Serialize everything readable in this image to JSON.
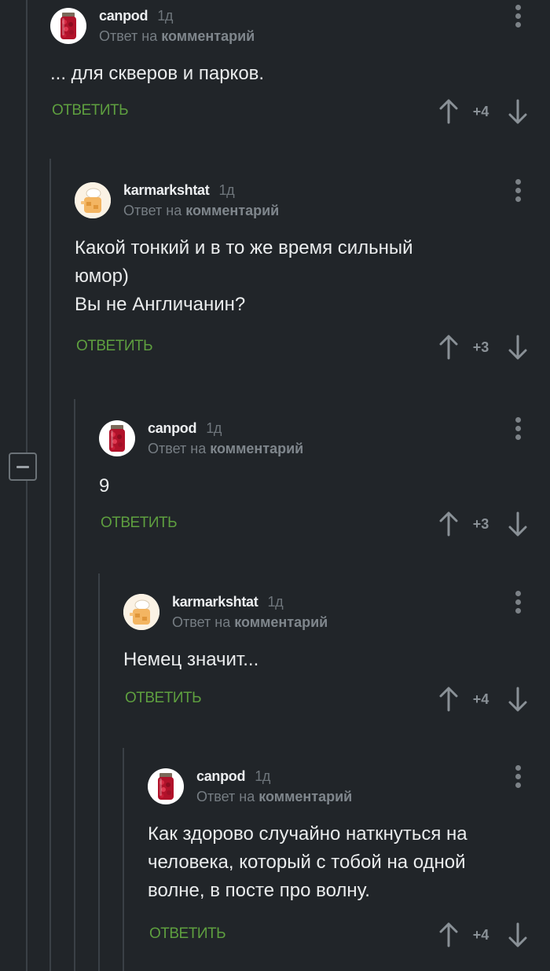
{
  "comments": [
    {
      "username": "canpod",
      "time": "1д",
      "reply_prefix": "Ответ на",
      "reply_target": "комментарий",
      "body": [
        "... для скверов и парков."
      ],
      "reply_label": "ОТВЕТИТЬ",
      "score": "+4",
      "avatar": "jar-avatar"
    },
    {
      "username": "karmarkshtat",
      "time": "1д",
      "reply_prefix": "Ответ на",
      "reply_target": "комментарий",
      "body": [
        "Какой тонкий и в то же время сильный",
        "юмор)",
        "Вы не Англичанин?"
      ],
      "reply_label": "ОТВЕТИТЬ",
      "score": "+3",
      "avatar": "chef-avatar"
    },
    {
      "username": "canpod",
      "time": "1д",
      "reply_prefix": "Ответ на",
      "reply_target": "комментарий",
      "body": [
        "9"
      ],
      "reply_label": "ОТВЕТИТЬ",
      "score": "+3",
      "avatar": "jar-avatar"
    },
    {
      "username": "karmarkshtat",
      "time": "1д",
      "reply_prefix": "Ответ на",
      "reply_target": "комментарий",
      "body": [
        "Немец значит..."
      ],
      "reply_label": "ОТВЕТИТЬ",
      "score": "+4",
      "avatar": "chef-avatar"
    },
    {
      "username": "canpod",
      "time": "1д",
      "reply_prefix": "Ответ на",
      "reply_target": "комментарий",
      "body": [
        "Как здорово случайно наткнуться на",
        "человека, который с тобой на одной",
        "волне, в посте про волну."
      ],
      "reply_label": "ОТВЕТИТЬ",
      "score": "+4",
      "avatar": "jar-avatar"
    }
  ],
  "colors": {
    "background": "#212529",
    "reply_link": "#5e9f3f",
    "thread_line": "#3a4046"
  },
  "icons": [
    "collapse-icon",
    "more-options-icon",
    "upvote-arrow-icon",
    "downvote-arrow-icon"
  ]
}
